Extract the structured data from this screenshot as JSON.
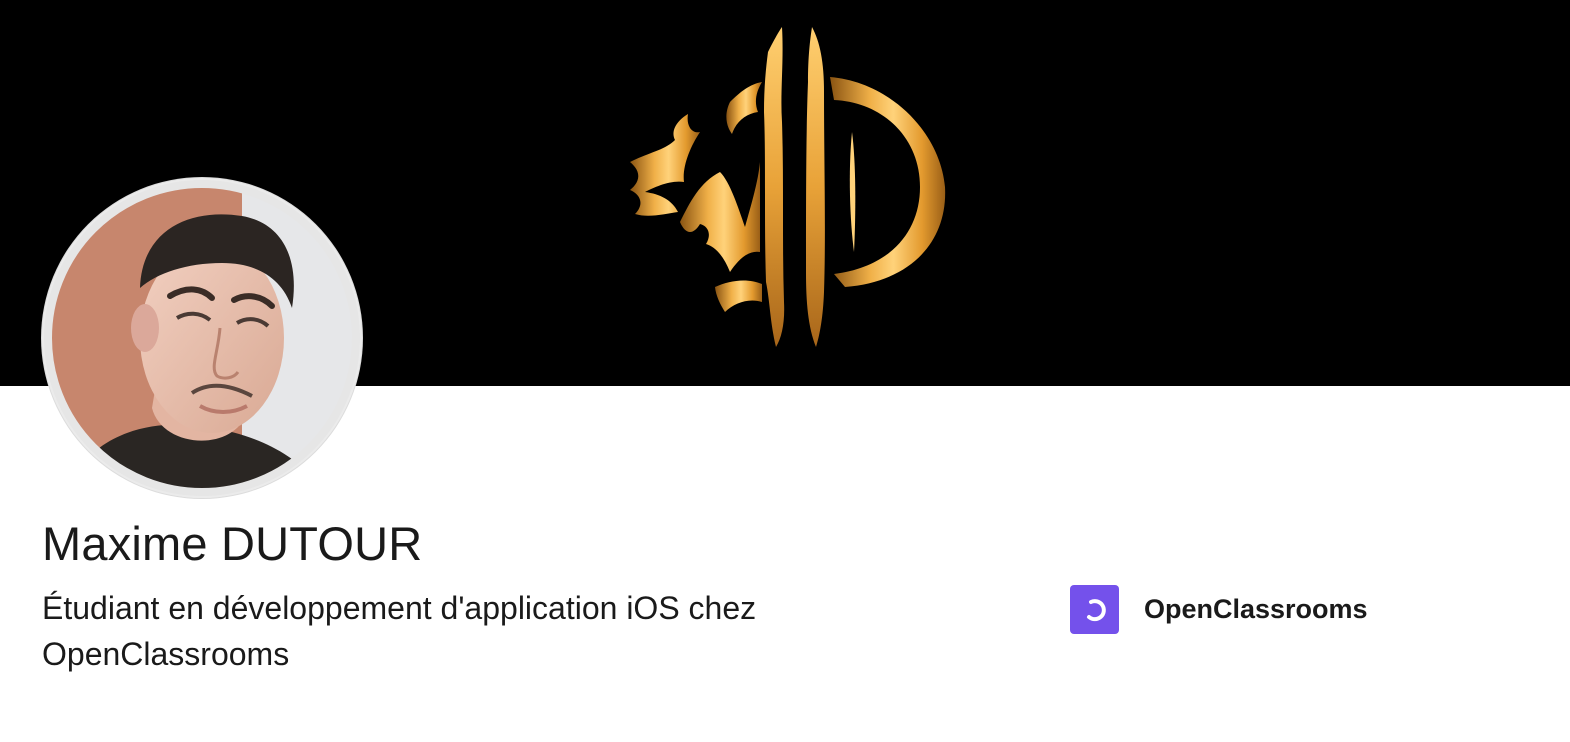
{
  "banner": {
    "logo_icon": "md-monogram-logo",
    "background_color": "#000000",
    "logo_color": "#e3a03a"
  },
  "profile": {
    "avatar_icon": "profile-photo",
    "name": "Maxime DUTOUR",
    "headline": "Étudiant en développement d'application iOS chez OpenClassrooms"
  },
  "organization": {
    "name": "OpenClassrooms",
    "logo_icon": "openclassrooms-logo",
    "logo_color": "#7451eb"
  }
}
